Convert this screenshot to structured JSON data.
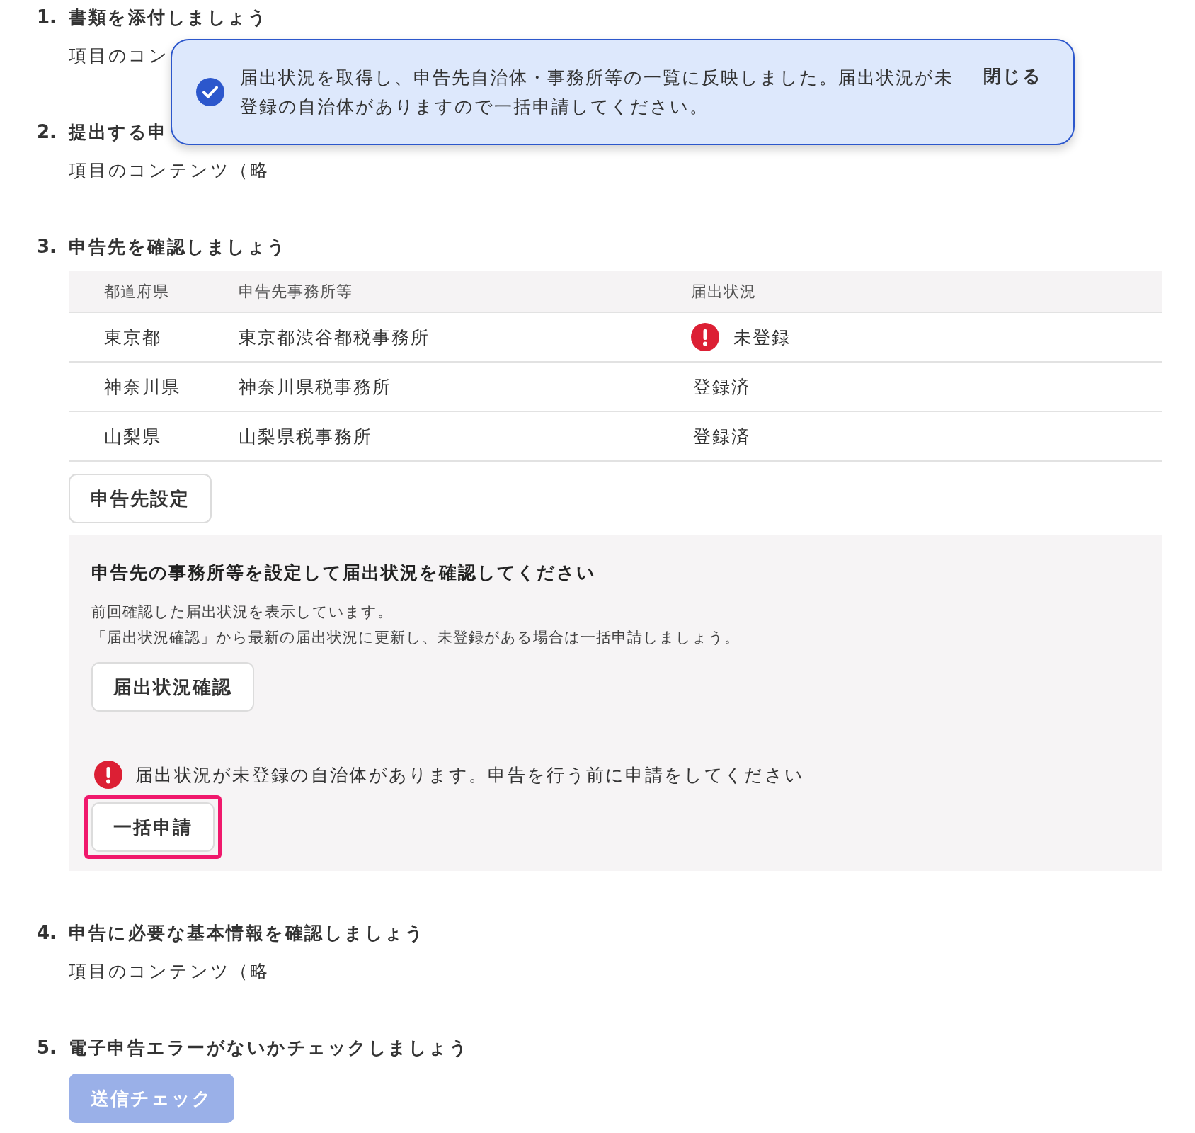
{
  "toast": {
    "message": "届出状況を取得し、申告先自治体・事務所等の一覧に反映しました。届出状況が未登録の自治体がありますので一括申請してください。",
    "close": "閉じる"
  },
  "steps": [
    {
      "number": "1.",
      "title": "書類を添付しましょう",
      "body": "項目のコン"
    },
    {
      "number": "2.",
      "title": "提出する申",
      "body": "項目のコンテンツ（略"
    },
    {
      "number": "3.",
      "title": "申告先を確認しましょう",
      "table": {
        "columns": [
          "都道府県",
          "申告先事務所等",
          "届出状況"
        ],
        "rows": [
          {
            "cells": [
              "東京都",
              "東京都渋谷都税事務所",
              "未登録"
            ],
            "warning": true
          },
          {
            "cells": [
              "神奈川県",
              "神奈川県税事務所",
              "登録済"
            ],
            "warning": false
          },
          {
            "cells": [
              "山梨県",
              "山梨県税事務所",
              "登録済"
            ],
            "warning": false
          }
        ]
      },
      "button": {
        "label": "申告先設定",
        "disabled": false
      },
      "panel": {
        "title": "申告先の事務所等を設定して届出状況を確認してください",
        "lines": [
          "前回確認した届出状況を表示しています。",
          "「届出状況確認」から最新の届出状況に更新し、未登録がある場合は一括申請しましょう。"
        ],
        "check_button": "届出状況確認",
        "alert": "届出状況が未登録の自治体があります。申告を行う前に申請をしてください",
        "bulk_button": {
          "label": "一括申請",
          "highlighted": true
        }
      }
    },
    {
      "number": "4.",
      "title": "申告に必要な基本情報を確認しましょう",
      "body": "項目のコンテンツ（略"
    },
    {
      "number": "5.",
      "title": "電子申告エラーがないかチェックしましょう",
      "button": {
        "label": "送信チェック",
        "disabled": true
      }
    }
  ]
}
